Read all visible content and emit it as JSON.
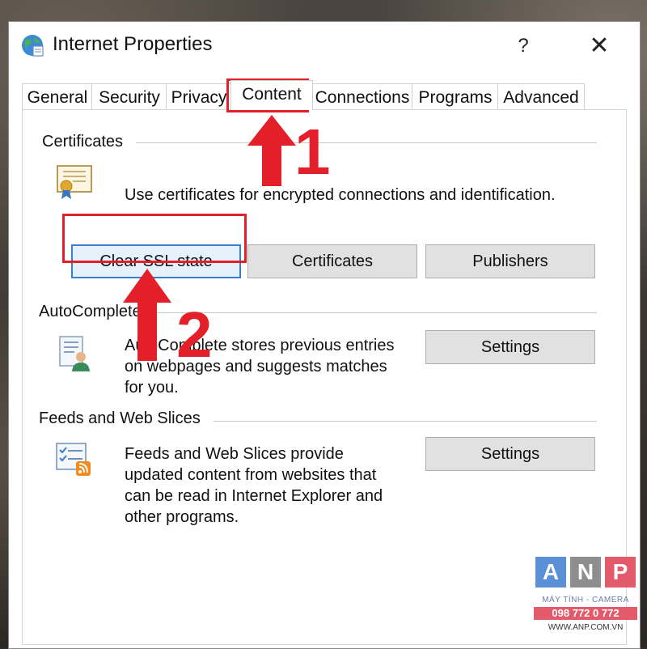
{
  "window": {
    "title": "Internet Properties",
    "help_label": "?",
    "close_label": "✕"
  },
  "tabs": [
    {
      "label": "General"
    },
    {
      "label": "Security"
    },
    {
      "label": "Privacy"
    },
    {
      "label": "Content",
      "active": true
    },
    {
      "label": "Connections"
    },
    {
      "label": "Programs"
    },
    {
      "label": "Advanced"
    }
  ],
  "certificates": {
    "group_label": "Certificates",
    "description": "Use certificates for encrypted connections and identification.",
    "buttons": {
      "clear_ssl": "Clear SSL state",
      "certificates": "Certificates",
      "publishers": "Publishers"
    }
  },
  "autocomplete": {
    "group_label": "AutoComplete",
    "description_lines": [
      "AutoComplete stores previous entries",
      "on webpages and suggests matches",
      "for you."
    ],
    "settings_label": "Settings"
  },
  "feeds": {
    "group_label": "Feeds and Web Slices",
    "description_lines": [
      "Feeds and Web Slices provide",
      "updated content from websites that",
      "can be read in Internet Explorer and",
      "other programs."
    ],
    "settings_label": "Settings"
  },
  "annotations": {
    "step1": "1",
    "step2": "2",
    "highlight_color": "#e3202a"
  },
  "watermark": {
    "letters": [
      "A",
      "N",
      "P"
    ],
    "tagline": "MÁY TÍNH - CAMERA",
    "phone": "098 772 0 772",
    "website": "WWW.ANP.COM.VN",
    "colors": {
      "a": "#5b8fd6",
      "n": "#8e8e8e",
      "p": "#e35b6a"
    }
  }
}
